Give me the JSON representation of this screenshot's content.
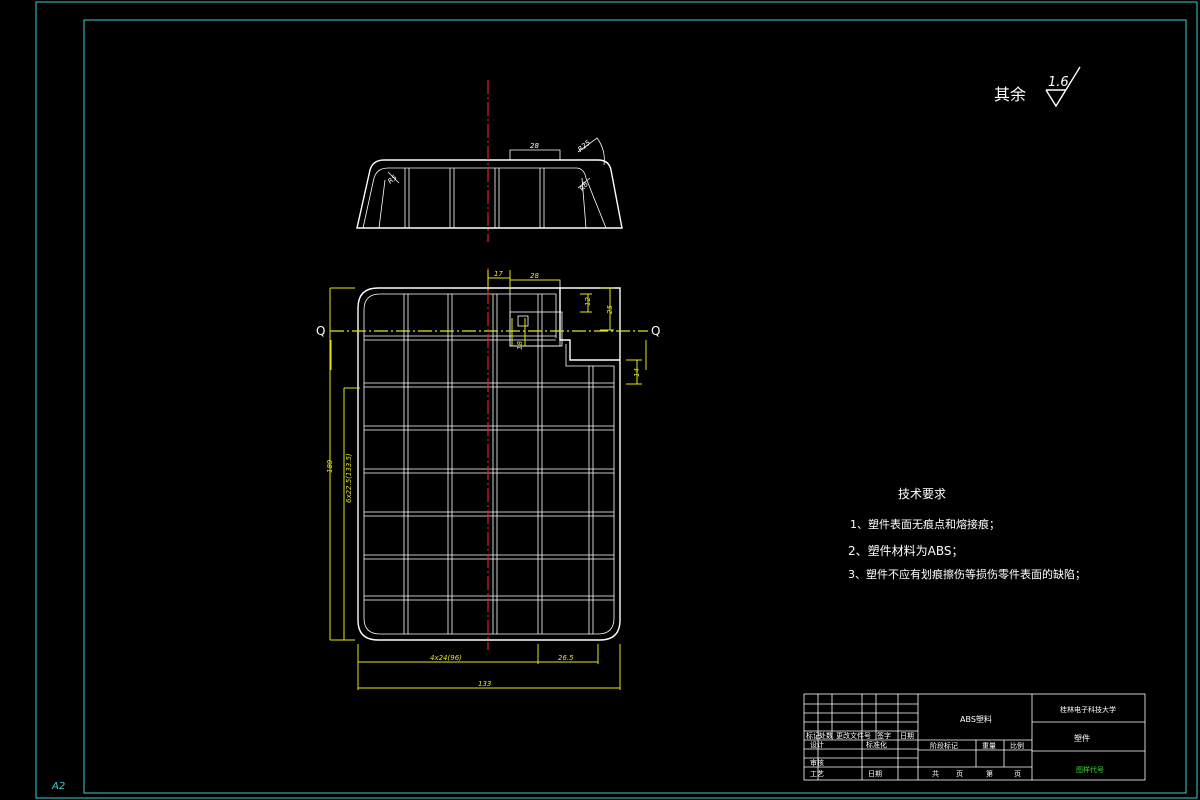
{
  "sheet": {
    "size_label": "A2"
  },
  "roughness": {
    "prefix": "其余",
    "value": "1.6"
  },
  "dims": {
    "top_28": "28",
    "r5": "R5",
    "r8": "R8",
    "r25": "R25",
    "plan_17": "17",
    "plan_28": "28",
    "plan_12": "12",
    "plan_25": "25",
    "plan_18": "18",
    "plan_14": "14",
    "left_overall": "189",
    "left_chain": "6x22.5(133.5)",
    "bottom_chain": "4x24(96)",
    "bottom_26": "26.5",
    "bottom_overall": "133"
  },
  "section": {
    "left": "Q",
    "right": "Q"
  },
  "tech": {
    "title": "技术要求",
    "items": [
      "1、塑件表面无痕点和熔接痕；",
      "2、塑件材料为ABS；",
      "3、塑件不应有划痕擦伤等损伤零件表面的缺陷；"
    ]
  },
  "title_block": {
    "material": "ABS塑料",
    "school": "桂林电子科技大学",
    "part_name": "塑件",
    "drawing_no": "图样代号",
    "row_mark": [
      "标记",
      "处数",
      "更改文件号",
      "签字",
      "日期"
    ],
    "row_design": [
      "设计",
      "标准化"
    ],
    "row_check": "审核",
    "row_process": [
      "工艺",
      "日期"
    ],
    "stage_headers": [
      "阶段标记",
      "重量",
      "比例"
    ],
    "sheets": [
      "共",
      "页",
      "第",
      "页"
    ]
  }
}
